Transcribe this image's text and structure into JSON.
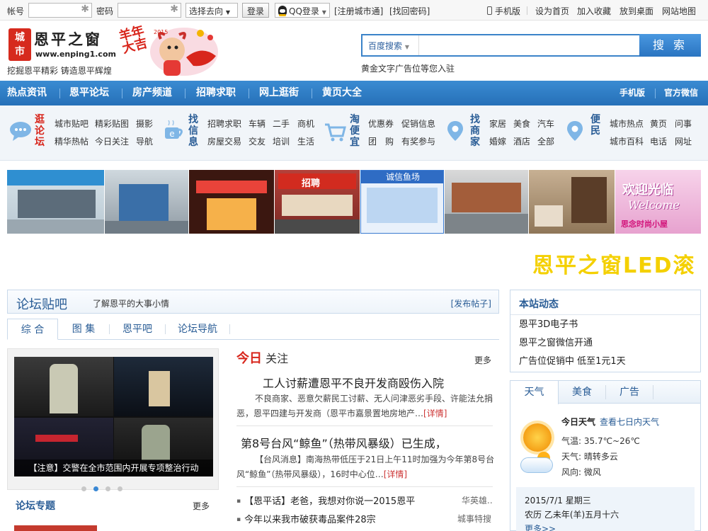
{
  "topbar": {
    "account_label": "帐号",
    "password_label": "密码",
    "direction_select": "选择去向",
    "login_button": "登录",
    "qq_login": "QQ登录",
    "register_link": "[注册城市通]",
    "recover_link": "[找回密码]",
    "mobile_link": "手机版",
    "homepage_link": "设为首页",
    "favorite_link": "加入收藏",
    "desktop_link": "放到桌面",
    "sitemap_link": "网站地图"
  },
  "header": {
    "logo_badge_top": "城",
    "logo_badge_bottom": "市",
    "site_name": "恩平之窗",
    "site_url": "www.enping1.com",
    "slogan": "挖掘恩平精彩 铸造恩平辉煌",
    "banner_text_1": "羊年大吉",
    "banner_year": "2015",
    "search_engine": "百度搜索",
    "search_placeholder": "",
    "search_button": "搜 索",
    "ad_text": "黄金文字广告位等您入驻"
  },
  "nav": {
    "items": [
      "热点资讯",
      "恩平论坛",
      "房产频道",
      "招聘求职",
      "网上逛街",
      "黄页大全"
    ],
    "right_items": [
      "手机版",
      "官方微信"
    ]
  },
  "categories": [
    {
      "title": "逛论坛",
      "links": [
        "城市贴吧",
        "精彩贴图",
        "摄影",
        "精华热帖",
        "今日关注",
        "导航"
      ]
    },
    {
      "title": "找信息",
      "links": [
        "招聘求职",
        "车辆",
        "二手",
        "商机",
        "房屋交易",
        "交友",
        "培训",
        "生活"
      ]
    },
    {
      "title": "淘便宜",
      "links": [
        "优惠券",
        "促销信息",
        "团　购",
        "有奖参与"
      ]
    },
    {
      "title": "找商家",
      "links": [
        "家居",
        "美食",
        "汽车",
        "婚嫁",
        "酒店",
        "全部"
      ]
    },
    {
      "title": "便民",
      "links": [
        "城市热点",
        "黄页",
        "问事",
        "城市百科",
        "电话",
        "网址"
      ]
    }
  ],
  "photos": {
    "photo4_text": "招聘",
    "photo5_banner": "诚信鱼场",
    "photo8_text1": "欢迎光临",
    "photo8_text2": "Welcome",
    "photo8_text3": "思念时尚小屋"
  },
  "led_text": "恩平之窗LED滚",
  "forum": {
    "title": "论坛贴吧",
    "subtitle": "了解恩平的大事小情",
    "post_link": "[发布帖子]",
    "tabs": [
      "综 合",
      "图 集",
      "恩平吧",
      "论坛导航"
    ],
    "slide_caption": "【注意】交警在全市范围内开展专项整治行动",
    "topics_title": "论坛专题",
    "topics_more": "更多"
  },
  "today": {
    "title_red": "今日",
    "title_rest": "关注",
    "more": "更多",
    "headline1": "工人讨薪遭恩平不良开发商殴伤入院",
    "summary1a": "不良商家、恶意欠薪民工讨薪、无人问津恶劣手段、许能法允捐",
    "summary1b": "恶，恩平四建与开发商（恩平市嘉景置地房地产…",
    "detail": "[详情]",
    "headline2": "第8号台风“鲸鱼”（热带风暴级）已生成，",
    "summary2a": "【台风消息】南海热带低压于21日上午11时加强为今年第8号台",
    "summary2b": "风“鲸鱼”（热带风暴级），16时中心位…",
    "list": [
      {
        "text": "【恩平话】老爸，我想对你说一2015恩平",
        "src": "华英雄.."
      },
      {
        "text": "今年以来我市破获毒品案件28宗",
        "src": "城事特搜"
      }
    ]
  },
  "news": {
    "title": "本站动态",
    "items": [
      "恩平3D电子书",
      "恩平之窗微信开通",
      "广告位促销中 低至1元1天"
    ]
  },
  "weather": {
    "tabs": [
      "天气",
      "美食",
      "广告"
    ],
    "today_label": "今日天气",
    "seven_day": "查看七日内天气",
    "temp": "气温: 35.7℃~26℃",
    "sky": "天气: 晴转多云",
    "wind": "风向: 微风",
    "date": "2015/7/1 星期三",
    "lunar": "农历 乙未年(羊)五月十六",
    "more": "更多>>"
  },
  "colors": {
    "brand_blue": "#2a74c1",
    "accent_red": "#d62a1d",
    "led_yellow": "#f4d000"
  }
}
